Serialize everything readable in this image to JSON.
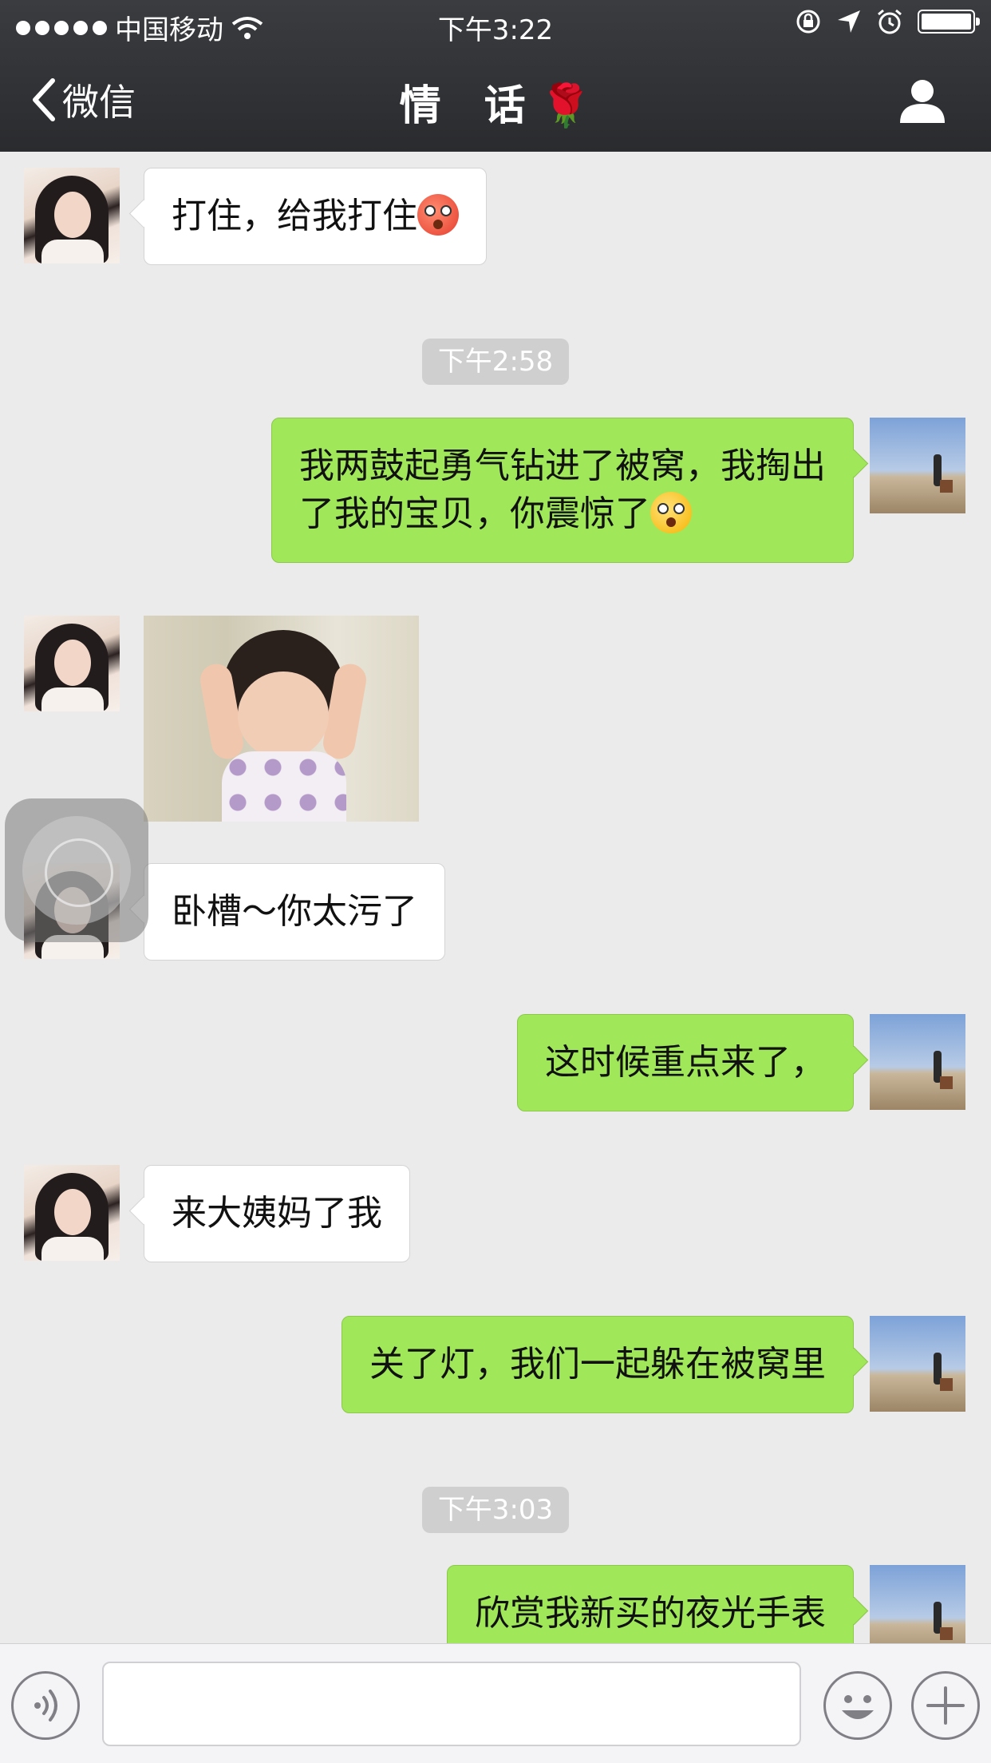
{
  "status_bar": {
    "carrier": "中国移动",
    "time": "下午3:22"
  },
  "nav": {
    "back_label": "微信",
    "title": "情 话",
    "title_emoji": "🌹"
  },
  "messages": [
    {
      "side": "in",
      "text": "打住，给我打住",
      "emoji": "flushed-face"
    },
    {
      "type": "time",
      "text": "下午2:58"
    },
    {
      "side": "out",
      "line1": "我两鼓起勇气钻进了被窝，我掏出",
      "line2": "了我的宝贝，你震惊了",
      "emoji": "astonished-face"
    },
    {
      "side": "in",
      "type": "image",
      "image_desc": "baby-holding-head-photo"
    },
    {
      "side": "in",
      "text": "卧槽～你太污了"
    },
    {
      "side": "out",
      "text": "这时候重点来了，"
    },
    {
      "side": "in",
      "text": "来大姨妈了我"
    },
    {
      "side": "out",
      "text": "关了灯，我们一起躲在被窝里"
    },
    {
      "type": "time",
      "text": "下午3:03"
    },
    {
      "side": "out",
      "text": "欣赏我新买的夜光手表"
    }
  ],
  "input": {
    "placeholder": ""
  },
  "colors": {
    "header_bg": "#2f3033",
    "chat_bg": "#ebebeb",
    "out_bubble": "#a0e75a",
    "in_bubble": "#ffffff"
  }
}
